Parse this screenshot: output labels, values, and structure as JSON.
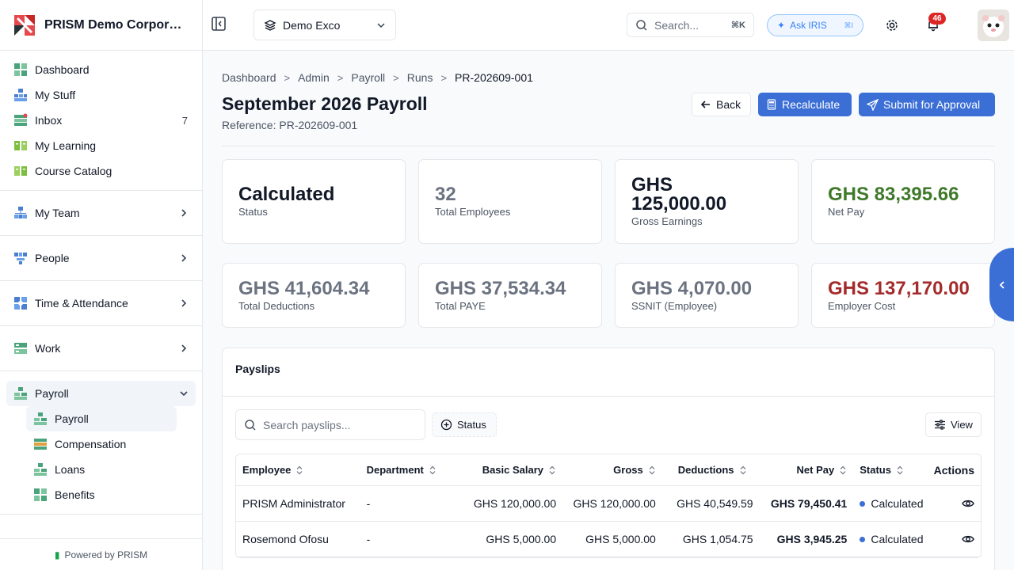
{
  "brand": {
    "name": "PRISM Demo Corporation"
  },
  "sidebar": {
    "group1": [
      {
        "label": "Dashboard",
        "icon": "dashboard-icon"
      },
      {
        "label": "My Stuff",
        "icon": "my-stuff-icon"
      },
      {
        "label": "Inbox",
        "icon": "inbox-icon",
        "count": "7"
      },
      {
        "label": "My Learning",
        "icon": "book-icon"
      },
      {
        "label": "Course Catalog",
        "icon": "catalog-icon"
      }
    ],
    "my_team": "My Team",
    "people": "People",
    "time_attendance": "Time & Attendance",
    "work": "Work",
    "payroll": "Payroll",
    "payroll_sub": [
      "Payroll",
      "Compensation",
      "Loans",
      "Benefits"
    ],
    "footer": "Powered by PRISM"
  },
  "header": {
    "org": "Demo Exco",
    "search_placeholder": "Search...",
    "search_shortcut": "⌘K",
    "ask": "Ask IRIS",
    "ask_shortcut": "⌘I",
    "notifications": "46"
  },
  "breadcrumb": [
    "Dashboard",
    "Admin",
    "Payroll",
    "Runs",
    "PR-202609-001"
  ],
  "page": {
    "title": "September 2026 Payroll",
    "reference": "Reference: PR-202609-001",
    "back": "Back",
    "recalculate": "Recalculate",
    "submit": "Submit for Approval"
  },
  "stats": [
    {
      "value": "Calculated",
      "label": "Status"
    },
    {
      "value": "32",
      "label": "Total Employees"
    },
    {
      "value": "GHS 125,000.00",
      "label": "Gross Earnings"
    },
    {
      "value": "GHS 83,395.66",
      "label": "Net Pay"
    },
    {
      "value": "GHS 41,604.34",
      "label": "Total Deductions"
    },
    {
      "value": "GHS 37,534.34",
      "label": "Total PAYE"
    },
    {
      "value": "GHS 4,070.00",
      "label": "SSNIT (Employee)"
    },
    {
      "value": "GHS 137,170.00",
      "label": "Employer Cost"
    }
  ],
  "payslips": {
    "title": "Payslips",
    "search_placeholder": "Search payslips...",
    "status_filter": "Status",
    "view": "View",
    "columns": [
      "Employee",
      "Department",
      "Basic Salary",
      "Gross",
      "Deductions",
      "Net Pay",
      "Status",
      "Actions"
    ],
    "rows": [
      {
        "employee": "PRISM Administrator",
        "department": "-",
        "basic": "GHS 120,000.00",
        "gross": "GHS 120,000.00",
        "deductions": "GHS 40,549.59",
        "net": "GHS 79,450.41",
        "status": "Calculated"
      },
      {
        "employee": "Rosemond Ofosu",
        "department": "-",
        "basic": "GHS 5,000.00",
        "gross": "GHS 5,000.00",
        "deductions": "GHS 1,054.75",
        "net": "GHS 3,945.25",
        "status": "Calculated"
      }
    ]
  },
  "colors": {
    "accent": "#3b6fd6",
    "net_pay": "#3f7a2b",
    "employer_cost": "#a32b2b",
    "badge": "#dc2626"
  }
}
